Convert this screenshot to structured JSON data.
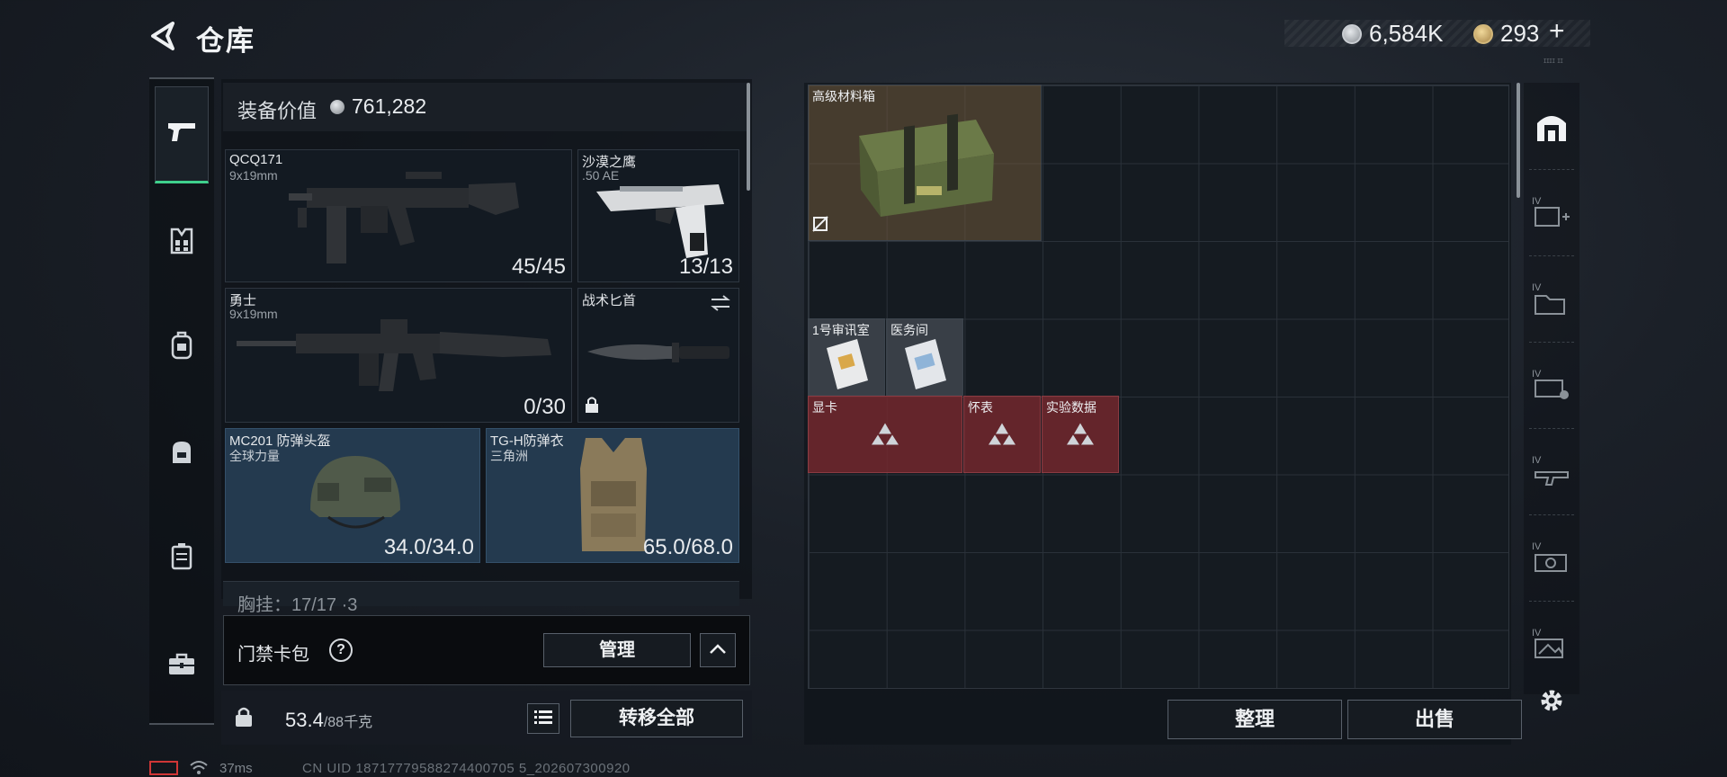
{
  "header": {
    "title": "仓库",
    "money": "6,584K",
    "gold": "293",
    "gold_plus": "+",
    "version": "ɪɪɪɪ ɪɪ"
  },
  "rail": {
    "items": [
      {
        "icon": "pistol-icon"
      },
      {
        "icon": "chest-rig-icon"
      },
      {
        "icon": "backpack-icon"
      },
      {
        "icon": "bag-icon"
      },
      {
        "icon": "case-icon"
      },
      {
        "icon": "toolbox-icon"
      }
    ]
  },
  "equipment": {
    "label": "装备价值",
    "value": "761,282",
    "slots": [
      {
        "name": "QCQ171",
        "sub": "9x19mm",
        "count": "45/45"
      },
      {
        "name": "沙漠之鹰",
        "sub": ".50 AE",
        "count": "13/13"
      },
      {
        "name": "勇士",
        "sub": "9x19mm",
        "count": "0/30"
      },
      {
        "name": "战术匕首",
        "sub": "",
        "count": ""
      },
      {
        "name": "MC201 防弹头盔",
        "sub": "全球力量",
        "count": "34.0/34.0"
      },
      {
        "name": "TG-H防弹衣",
        "sub": "三角洲",
        "count": "65.0/68.0"
      }
    ],
    "partial_row": "胸挂：17/17 ·3"
  },
  "keycard": {
    "label": "门禁卡包",
    "help": "?",
    "manage": "管理"
  },
  "bottom_left": {
    "weight_value": "53.4",
    "weight_max": "/88千克",
    "transfer": "转移全部"
  },
  "status": {
    "ping": "37ms",
    "uid": "CN UID 18717779588274400705 5_202607300920"
  },
  "storage": {
    "items": [
      {
        "name": "高级材料箱"
      },
      {
        "name": "1号审讯室"
      },
      {
        "name": "医务间"
      },
      {
        "name": "显卡"
      },
      {
        "name": "怀表"
      },
      {
        "name": "实验数据"
      }
    ],
    "sort": "整理",
    "sell": "出售"
  },
  "right_rail": {
    "items": [
      {
        "icon": "storage-home-icon"
      },
      {
        "icon": "storage-add-icon",
        "tag": "IV"
      },
      {
        "icon": "storage-folder-icon",
        "tag": "IV"
      },
      {
        "icon": "storage-key-icon",
        "tag": "IV"
      },
      {
        "icon": "storage-weapon-icon",
        "tag": "IV"
      },
      {
        "icon": "storage-cash-icon",
        "tag": "IV"
      },
      {
        "icon": "storage-image-icon",
        "tag": "IV"
      },
      {
        "icon": "settings-icon"
      }
    ]
  },
  "colors": {
    "accent_green": "#3fd08c",
    "rare_red": "#782a2e",
    "slot_blue": "#243a4f"
  }
}
